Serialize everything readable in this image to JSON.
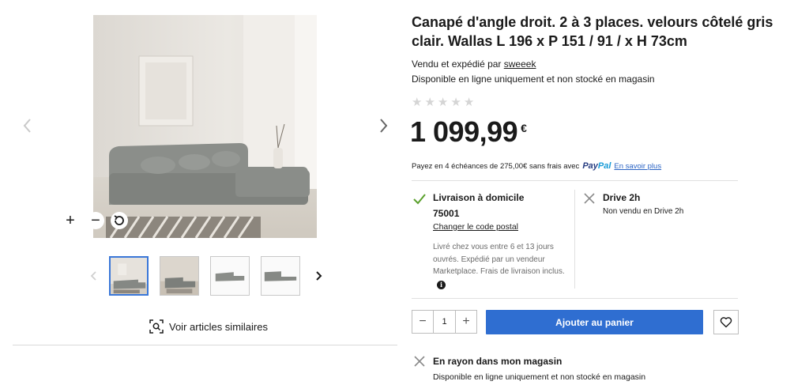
{
  "product": {
    "title": "Canapé d'angle droit. 2 à 3 places. velours côtelé gris clair. Wallas L 196 x P 151 / 91 / x H 73cm",
    "seller_prefix": "Vendu et expédié par ",
    "seller_name": "sweeek",
    "availability": "Disponible en ligne uniquement et non stocké en magasin",
    "rating_stars": 5,
    "rating_value": 0,
    "price": "1 099,99",
    "currency": "€"
  },
  "payment": {
    "text": "Payez en 4 échéances de 275,00€ sans frais avec",
    "brand_pay": "Pay",
    "brand_pal": "Pal",
    "link": "En savoir plus"
  },
  "delivery": {
    "title": "Livraison à domicile",
    "zip": "75001",
    "change_link": "Changer le code postal",
    "info": "Livré chez vous entre 6 et 13 jours ouvrés. Expédié par un vendeur Marketplace. Frais de livraison inclus.",
    "info_icon": "i",
    "status_icon": "check-icon",
    "status_color": "#5aa02c"
  },
  "drive": {
    "title": "Drive 2h",
    "subtitle": "Non vendu en Drive 2h",
    "status_icon": "x-icon"
  },
  "cart": {
    "qty_minus": "−",
    "qty_value": "1",
    "qty_plus": "+",
    "add_label": "Ajouter au panier",
    "accent": "#2f6ed1"
  },
  "store": {
    "title": "En rayon dans mon magasin",
    "subtitle": "Disponible en ligne uniquement et non stocké en magasin",
    "status_icon": "x-icon"
  },
  "gallery": {
    "zoom_in": "+",
    "zoom_out": "−",
    "thumbnail_count": 4,
    "active_thumbnail": 1,
    "similar_label": "Voir articles similaires"
  }
}
